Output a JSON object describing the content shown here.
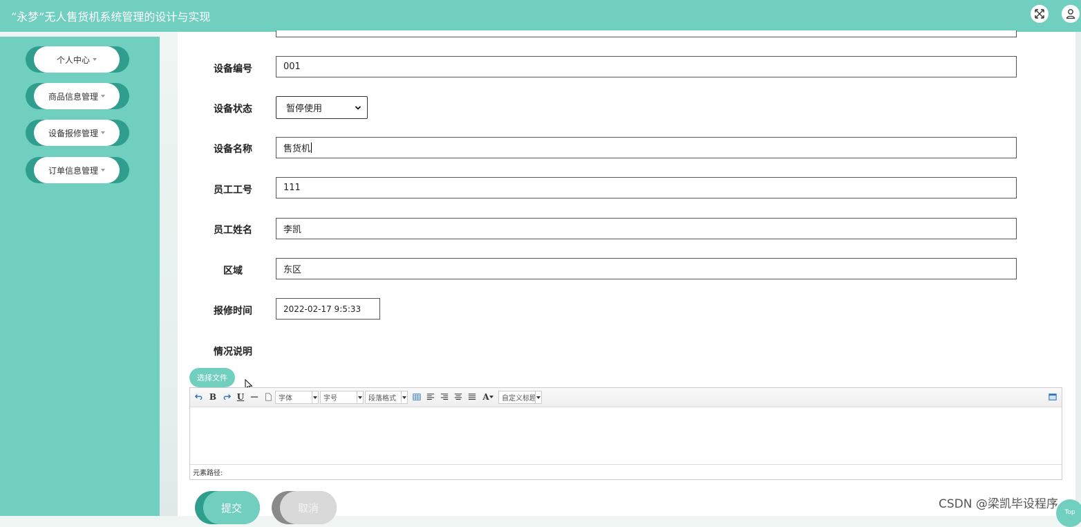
{
  "header": {
    "title": "“永梦”无人售货机系统管理的设计与实现",
    "icons": [
      "fullscreen-icon",
      "user-icon"
    ]
  },
  "sidebar": {
    "items": [
      {
        "label": "个人中心"
      },
      {
        "label": "商品信息管理"
      },
      {
        "label": "设备报修管理"
      },
      {
        "label": "订单信息管理"
      }
    ]
  },
  "form": {
    "device_no": {
      "label": "设备编号",
      "value": "001"
    },
    "device_status": {
      "label": "设备状态",
      "value": "暂停使用"
    },
    "device_name": {
      "label": "设备名称",
      "value": "售货机"
    },
    "employee_no": {
      "label": "员工工号",
      "value": "111"
    },
    "employee_name": {
      "label": "员工姓名",
      "value": "李凯"
    },
    "region": {
      "label": "区域",
      "value": "东区"
    },
    "repair_time": {
      "label": "报修时间",
      "value": "2022-02-17 9:5:33"
    },
    "description": {
      "label": "情况说明"
    }
  },
  "upload": {
    "label": "选择文件"
  },
  "editor": {
    "font_label": "字体",
    "size_label": "字号",
    "paragraph_label": "段落格式",
    "custom_title_label": "自定义标题",
    "status_path": "元素路径:"
  },
  "actions": {
    "submit": "提交",
    "cancel": "取消"
  },
  "watermark": "CSDN @梁凯毕设程序",
  "back_to_top": "Top",
  "colors": {
    "primary": "#71cfc0",
    "primary_dark": "#2f9e8d"
  }
}
